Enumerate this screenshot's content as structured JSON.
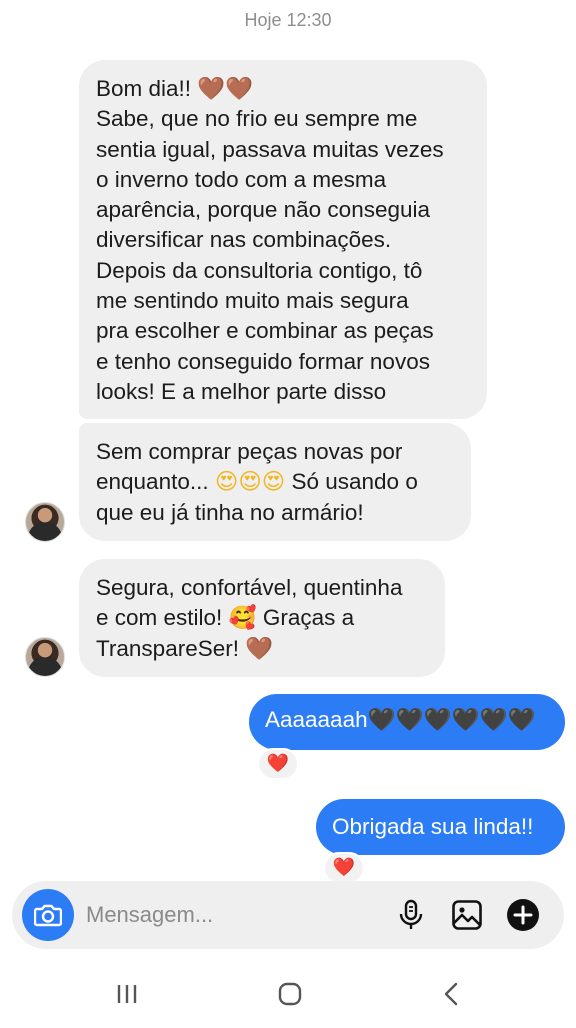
{
  "header": {
    "timestamp": "Hoje 12:30"
  },
  "messages": [
    {
      "direction": "incoming",
      "lines": [
        "Bom dia!! ",
        "Sabe, que no frio eu sempre me",
        "sentia igual, passava muitas vezes",
        "o inverno todo com a mesma",
        "aparência, porque não conseguia",
        "diversificar nas combinações.",
        "Depois da consultoria contigo, tô",
        "me sentindo muito mais segura",
        "pra escolher e combinar as peças",
        "e tenho conseguido formar novos",
        "looks! E a melhor parte disso"
      ],
      "emoji": "🤎🤎"
    },
    {
      "direction": "incoming",
      "line1": "Sem comprar peças novas por",
      "line2_start": "enquanto... ",
      "line2_emoji": "😍😍😍",
      "line2_end": " Só usando o",
      "line3": "que eu já tinha no armário!"
    },
    {
      "direction": "incoming",
      "line1": "Segura, confortável, quentinha",
      "line2_start": "e com estilo! ",
      "line2_emoji": "🥰",
      "line2_end": " Graças a",
      "line3_start": "TranspareSer! ",
      "line3_emoji": "🤎"
    },
    {
      "direction": "outgoing",
      "text": "Aaaaaaah",
      "emoji": "🖤🖤🖤🖤🖤🖤",
      "reaction": "❤️"
    },
    {
      "direction": "outgoing",
      "text": "Obrigada sua linda!!",
      "reaction": "❤️"
    }
  ],
  "composer": {
    "placeholder": "Mensagem...",
    "icons": [
      "camera-icon",
      "microphone-icon",
      "gallery-icon",
      "plus-icon"
    ]
  },
  "navbar": {
    "icons": [
      "recent-apps-icon",
      "home-icon",
      "back-icon"
    ]
  },
  "colors": {
    "accent": "#2c7cf6",
    "incoming_bubble": "#efefef",
    "reaction_heart": "#e32940"
  }
}
